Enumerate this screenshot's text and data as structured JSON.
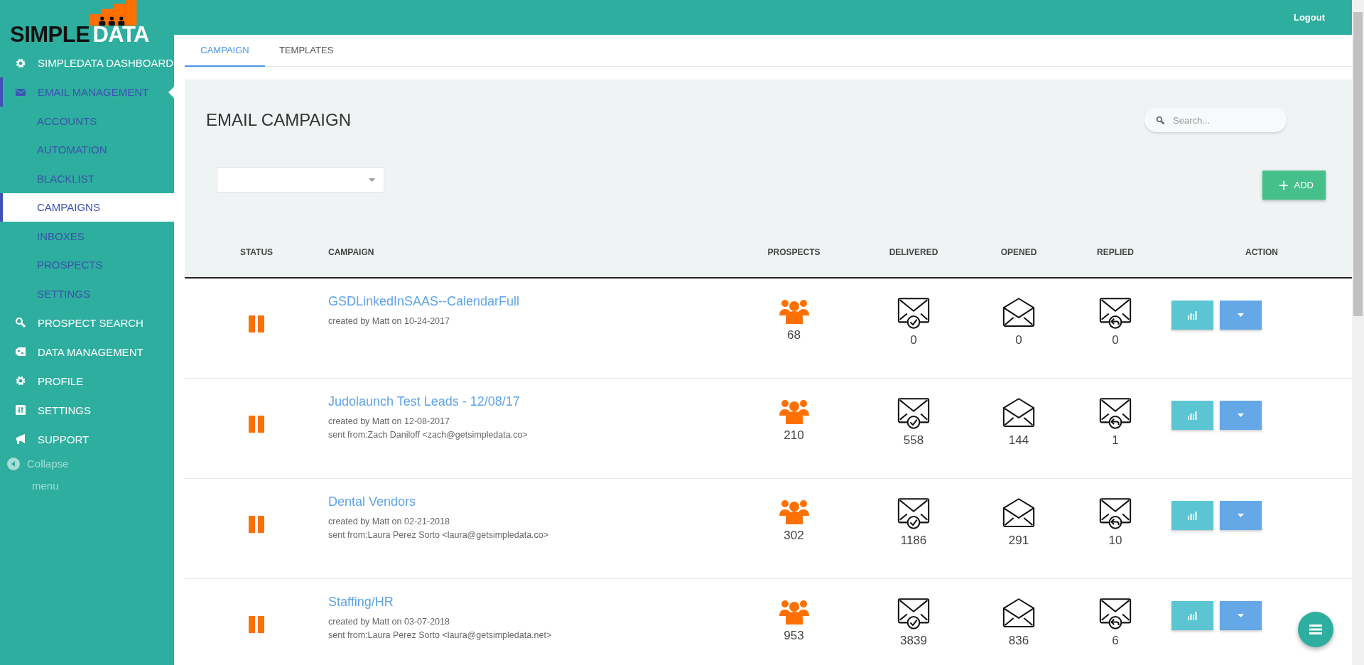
{
  "logo": {
    "words": [
      "SIMPLE",
      "DATA"
    ]
  },
  "topbar": {
    "logout": "Logout"
  },
  "sidebar": {
    "items": [
      {
        "label": "SIMPLEDATA DASHBOARD",
        "expanded": false
      },
      {
        "label": "EMAIL MANAGEMENT",
        "expanded": true,
        "children": [
          {
            "label": "ACCOUNTS",
            "selected": false
          },
          {
            "label": "AUTOMATION",
            "selected": false
          },
          {
            "label": "BLACKLIST",
            "selected": false
          },
          {
            "label": "CAMPAIGNS",
            "selected": true
          },
          {
            "label": "INBOXES",
            "selected": false
          },
          {
            "label": "PROSPECTS",
            "selected": false
          },
          {
            "label": "SETTINGS",
            "selected": false
          }
        ]
      },
      {
        "label": "PROSPECT SEARCH",
        "expanded": false
      },
      {
        "label": "DATA MANAGEMENT",
        "expanded": false
      },
      {
        "label": "PROFILE",
        "expanded": false
      },
      {
        "label": "SETTINGS",
        "expanded": false
      },
      {
        "label": "SUPPORT",
        "expanded": false
      }
    ],
    "collapse": {
      "label": "Collapse",
      "sublabel": "menu"
    }
  },
  "tabs": [
    {
      "label": "CAMPAIGN",
      "selected": true
    },
    {
      "label": "TEMPLATES",
      "selected": false
    }
  ],
  "panel": {
    "title": "EMAIL CAMPAIGN",
    "search": {
      "placeholder": "Search..."
    },
    "add_button": "ADD"
  },
  "table": {
    "columns": [
      "STATUS",
      "CAMPAIGN",
      "PROSPECTS",
      "DELIVERED",
      "OPENED",
      "REPLIED",
      "ACTION"
    ],
    "rows": [
      {
        "paused": true,
        "name": "GSDLinkedInSAAS--CalendarFull",
        "created": "created by Matt on 10-24-2017",
        "prospects": "68",
        "delivered": "0",
        "opened": "0",
        "replied": "0"
      },
      {
        "paused": true,
        "name": "Judolaunch Test Leads - 12/08/17",
        "created": "created by Matt on 12-08-2017",
        "sent_from": "sent from:Zach Daniloff <zach@getsimpledata.co>",
        "prospects": "210",
        "delivered": "558",
        "opened": "144",
        "replied": "1"
      },
      {
        "paused": true,
        "name": "Dental Vendors",
        "created": "created by Matt on 02-21-2018",
        "sent_from": "sent from:Laura Perez Sorto <laura@getsimpledata.co>",
        "prospects": "302",
        "delivered": "1186",
        "opened": "291",
        "replied": "10"
      },
      {
        "paused": true,
        "name": "Staffing/HR",
        "created": "created by Matt on 03-07-2018",
        "sent_from": "sent from:Laura Perez Sorto <laura@getsimpledata.net>",
        "prospects": "953",
        "delivered": "3839",
        "opened": "836",
        "replied": "6"
      }
    ]
  }
}
